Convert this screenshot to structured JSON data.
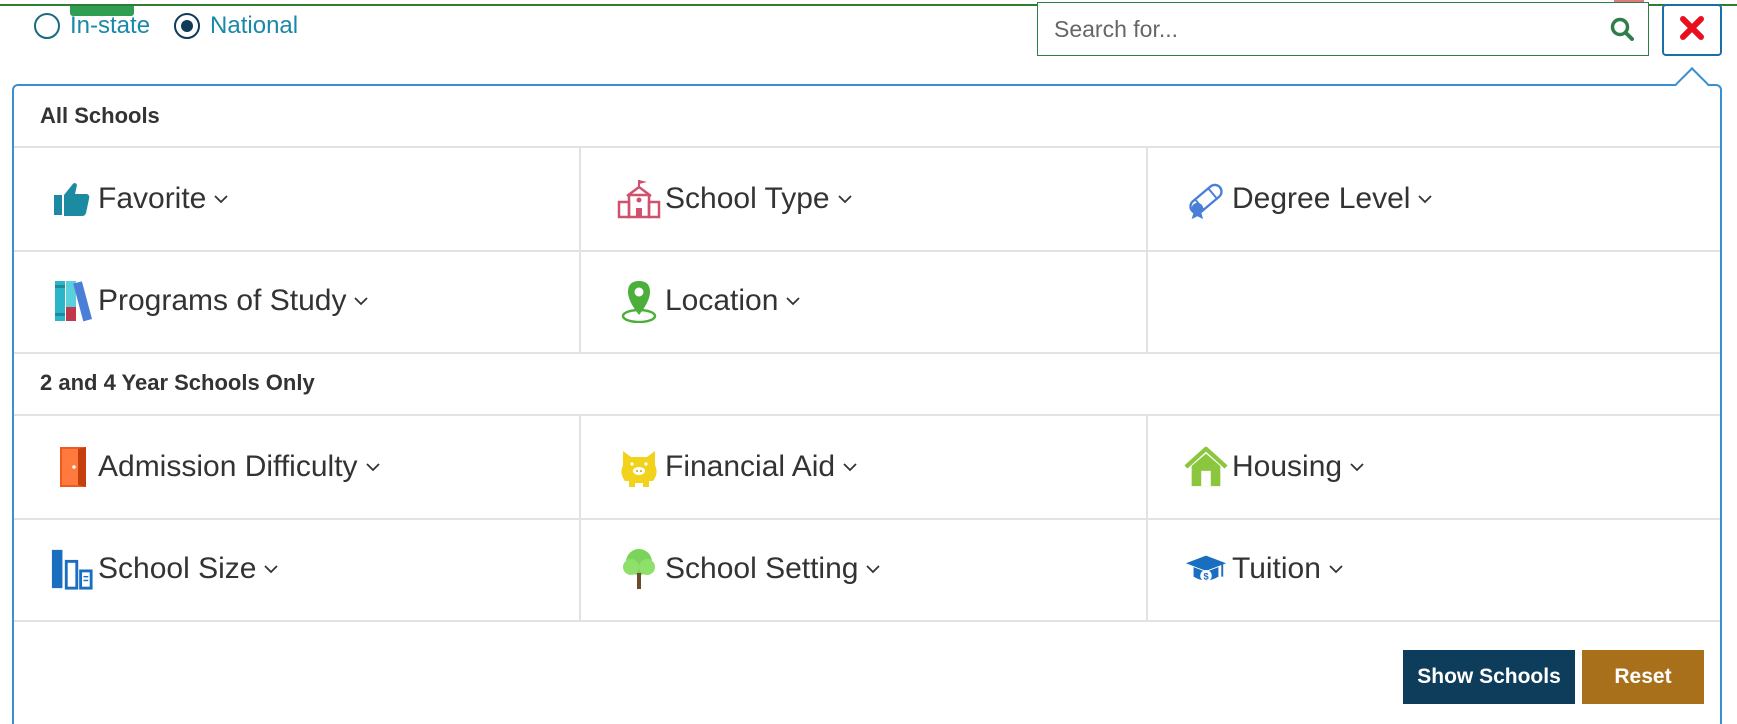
{
  "scope": {
    "options": [
      {
        "label": "In-state",
        "checked": false
      },
      {
        "label": "National",
        "checked": true
      }
    ]
  },
  "search": {
    "placeholder": "Search for...",
    "value": ""
  },
  "close": {
    "icon": "close-icon",
    "color": "#e8101e"
  },
  "sections": [
    {
      "title": "All Schools",
      "rows": [
        [
          {
            "label": "Favorite",
            "icon": "thumbs-up-icon"
          },
          {
            "label": "School Type",
            "icon": "school-building-icon"
          },
          {
            "label": "Degree Level",
            "icon": "diploma-icon"
          }
        ],
        [
          {
            "label": "Programs of Study",
            "icon": "books-icon"
          },
          {
            "label": "Location",
            "icon": "map-pin-icon"
          },
          {
            "label": "",
            "icon": ""
          }
        ]
      ]
    },
    {
      "title": "2 and 4 Year Schools Only",
      "rows": [
        [
          {
            "label": "Admission Difficulty",
            "icon": "door-icon"
          },
          {
            "label": "Financial Aid",
            "icon": "piggy-bank-icon"
          },
          {
            "label": "Housing",
            "icon": "house-icon"
          }
        ],
        [
          {
            "label": "School Size",
            "icon": "size-bars-icon"
          },
          {
            "label": "School Setting",
            "icon": "tree-icon"
          },
          {
            "label": "Tuition",
            "icon": "graduation-cap-dollar-icon"
          }
        ]
      ]
    }
  ],
  "actions": {
    "show": "Show Schools",
    "reset": "Reset"
  },
  "colors": {
    "accent": "#1a88a8",
    "panel_border": "#3a8fd0",
    "show_button": "#0e3d5c",
    "reset_button": "#a8701a"
  }
}
